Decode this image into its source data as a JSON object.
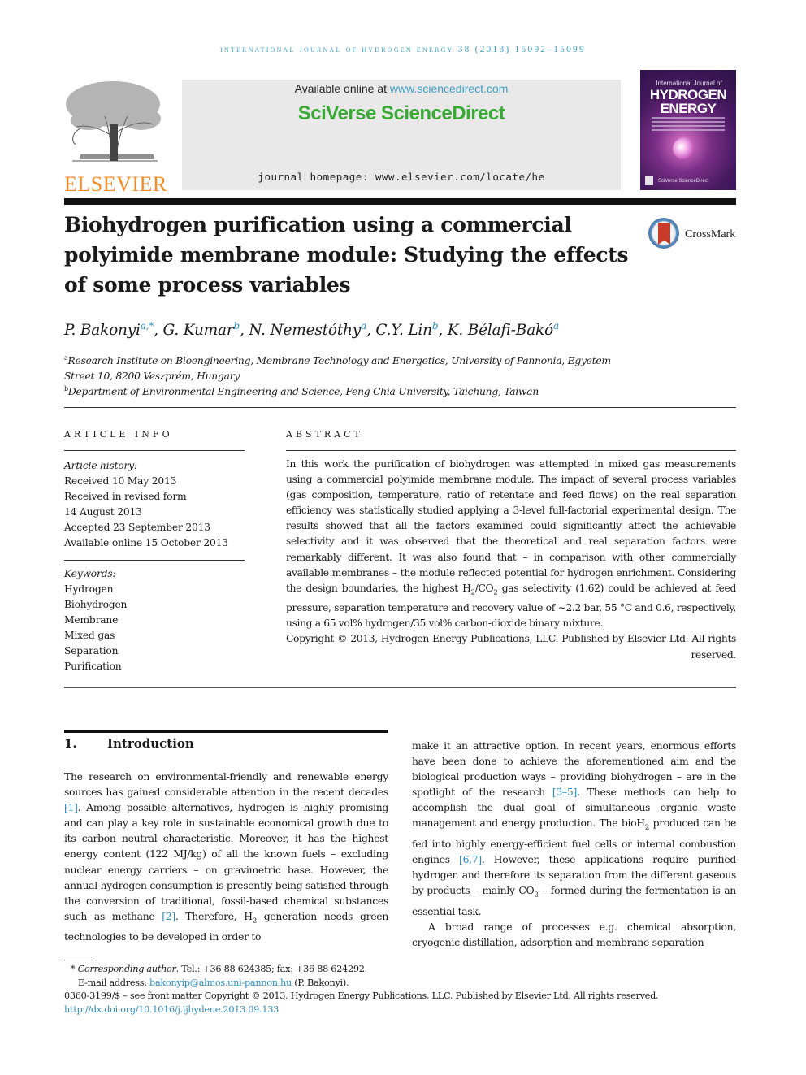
{
  "journal_header": {
    "running_head": "INTERNATIONAL JOURNAL OF HYDROGEN ENERGY 38 (2013) 15092–15099"
  },
  "publisher": {
    "logo_text": "ELSEVIER",
    "logo_icon": "elsevier-tree-icon",
    "brand_color": "#f28c28"
  },
  "banner": {
    "available_prefix": "Available online at ",
    "available_link": "www.sciencedirect.com",
    "platform_name": "SciVerse ScienceDirect",
    "platform_color": "#3aa935",
    "homepage": "journal homepage: www.elsevier.com/locate/he"
  },
  "cover": {
    "line1": "International Journal of",
    "line2": "HYDROGEN",
    "line3": "ENERGY",
    "footer": "SciVerse ScienceDirect"
  },
  "crossmark": {
    "label": "CrossMark",
    "icon": "crossmark-icon"
  },
  "article": {
    "title": "Biohydrogen purification using a commercial polyimide membrane module: Studying the effects of some process variables",
    "authors": [
      {
        "name": "P. Bakonyi",
        "sup": "a,*"
      },
      {
        "name": "G. Kumar",
        "sup": "b"
      },
      {
        "name": "N. Nemestóthy",
        "sup": "a"
      },
      {
        "name": "C.Y. Lin",
        "sup": "b"
      },
      {
        "name": "K. Bélafi-Bakó",
        "sup": "a"
      }
    ],
    "affiliations": [
      {
        "mark": "a",
        "text": "Research Institute on Bioengineering, Membrane Technology and Energetics, University of Pannonia, Egyetem Street 10, 8200 Veszprém, Hungary"
      },
      {
        "mark": "b",
        "text": "Department of Environmental Engineering and Science, Feng Chia University, Taichung, Taiwan"
      }
    ]
  },
  "article_info": {
    "heading": "ARTICLE INFO",
    "history_label": "Article history:",
    "history": [
      "Received 10 May 2013",
      "Received in revised form",
      "14 August 2013",
      "Accepted 23 September 2013",
      "Available online 15 October 2013"
    ],
    "keywords_label": "Keywords:",
    "keywords": [
      "Hydrogen",
      "Biohydrogen",
      "Membrane",
      "Mixed gas",
      "Separation",
      "Purification"
    ]
  },
  "abstract": {
    "heading": "ABSTRACT",
    "text_part1": "In this work the purification of biohydrogen was attempted in mixed gas measurements using a commercial polyimide membrane module. The impact of several process variables (gas composition, temperature, ratio of retentate and feed flows) on the real separation efficiency was statistically studied applying a 3-level full-factorial experimental design. The results showed that all the factors examined could significantly affect the achievable selectivity and it was observed that the theoretical and real separation factors were remarkably different. It was also found that – in comparison with other commercially available membranes – the module reflected potential for hydrogen enrichment. Considering the design boundaries, the highest H",
    "text_part2": "/CO",
    "text_part3": " gas selectivity (1.62) could be achieved at feed pressure, separation temperature and recovery value of ∼2.2 bar, 55 °C and 0.6, respectively, using a 65 vol% hydrogen/35 vol% carbon-dioxide binary mixture.",
    "sub_2": "2",
    "copyright_line": "Copyright © 2013, Hydrogen Energy Publications, LLC. Published by Elsevier Ltd. All rights",
    "copyright_end": "reserved."
  },
  "introduction": {
    "number": "1.",
    "title": "Introduction",
    "p1": [
      {
        "t": "The research on environmental-friendly and renewable energy sources has gained considerable attention in the recent decades "
      },
      {
        "ref": "[1]"
      },
      {
        "t": ". Among possible alternatives, hydrogen is highly promising and can play a key role in sustainable economical growth due to its carbon neutral characteristic. Moreover, it has the highest energy content (122 MJ/kg) of all the known fuels – excluding nuclear energy carriers – on gravimetric base. However, the annual hydrogen consumption is presently being satisfied through the conversion of traditional, fossil-based chemical substances such as methane "
      },
      {
        "ref": "[2]"
      },
      {
        "t": ". Therefore, H"
      },
      {
        "sub": "2"
      },
      {
        "t": " generation needs green technologies to be developed in order to make it an attractive option. In recent years, enormous efforts have been done to achieve the aforementioned aim and the biological production ways – providing biohydrogen – are in the spotlight of the research "
      },
      {
        "ref": "[3–5]"
      },
      {
        "t": ". These methods can help to accomplish the dual goal of simultaneous organic waste management and energy production. The bioH"
      },
      {
        "sub": "2"
      },
      {
        "t": " produced can be fed into highly energy-efficient fuel cells or internal combustion engines "
      },
      {
        "ref": "[6,7]"
      },
      {
        "t": ". However, these applications require purified hydrogen and therefore its separation from the different gaseous by-products – mainly CO"
      },
      {
        "sub": "2"
      },
      {
        "t": " – formed during the fermentation is an essential task."
      }
    ],
    "p2": "A broad range of processes e.g. chemical absorption, cryogenic distillation, adsorption and membrane separation"
  },
  "footnotes": {
    "corresponding_label": "Corresponding author",
    "corresponding_contact": ". Tel.: +36 88 624385; fax: +36 88 624292.",
    "email_label": "E-mail address: ",
    "email": "bakonyip@almos.uni-pannon.hu",
    "email_suffix": " (P. Bakonyi).",
    "issn_line": "0360-3199/$ – see front matter Copyright © 2013, Hydrogen Energy Publications, LLC. Published by Elsevier Ltd. All rights reserved.",
    "doi": "http://dx.doi.org/10.1016/j.ijhydene.2013.09.133"
  },
  "colors": {
    "link": "#2d8dc0",
    "running_head": "#3f9ec4"
  }
}
